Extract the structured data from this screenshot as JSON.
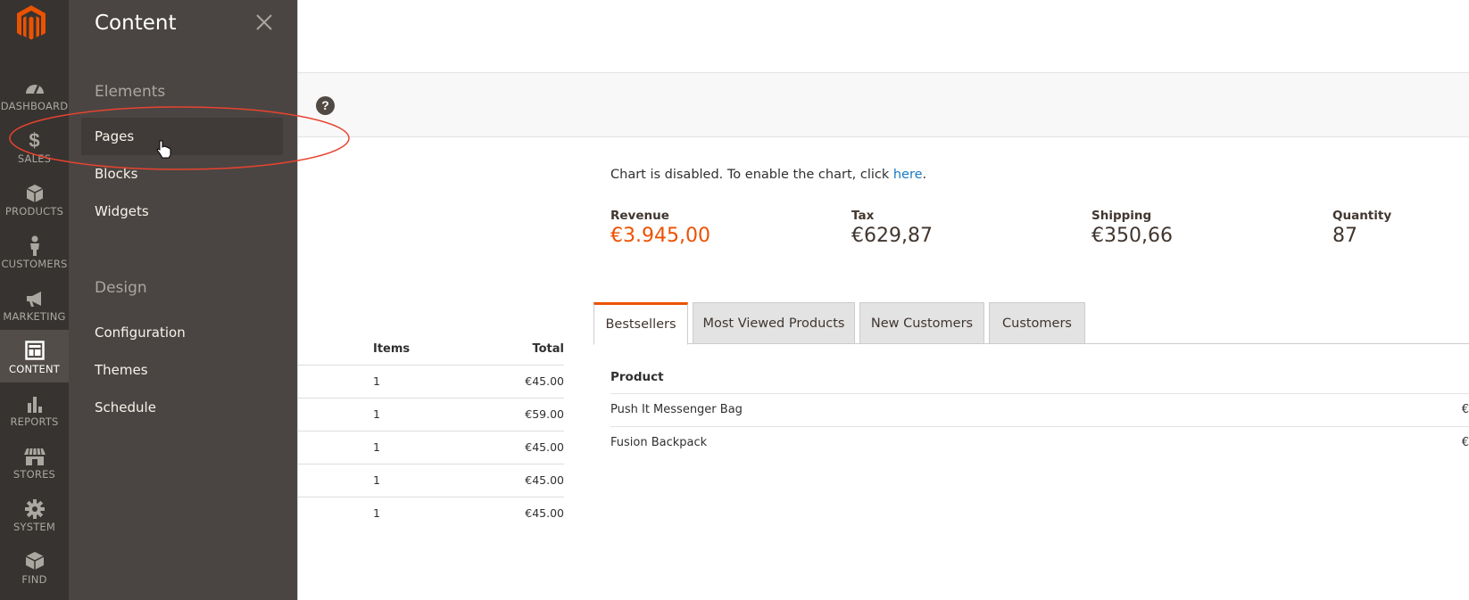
{
  "sidebar": {
    "items": [
      {
        "label": "DASHBOARD",
        "icon": "dashboard-icon"
      },
      {
        "label": "SALES",
        "icon": "dollar-icon"
      },
      {
        "label": "PRODUCTS",
        "icon": "box-icon"
      },
      {
        "label": "CUSTOMERS",
        "icon": "person-icon"
      },
      {
        "label": "MARKETING",
        "icon": "megaphone-icon"
      },
      {
        "label": "CONTENT",
        "icon": "layout-icon"
      },
      {
        "label": "REPORTS",
        "icon": "bar-chart-icon"
      },
      {
        "label": "STORES",
        "icon": "store-icon"
      },
      {
        "label": "SYSTEM",
        "icon": "gear-icon"
      },
      {
        "label": "FIND",
        "icon": "blocks-icon"
      }
    ],
    "active": "CONTENT"
  },
  "flyout": {
    "title": "Content",
    "sections": [
      {
        "heading": "Elements",
        "items": [
          "Pages",
          "Blocks",
          "Widgets"
        ]
      },
      {
        "heading": "Design",
        "items": [
          "Configuration",
          "Themes",
          "Schedule"
        ]
      }
    ]
  },
  "dashboard": {
    "chart_msg": "Chart is disabled. To enable the chart, click ",
    "chart_link": "here",
    "chart_msg_end": ".",
    "stats": [
      {
        "title": "Revenue",
        "value": "€3.945,00"
      },
      {
        "title": "Tax",
        "value": "€629,87"
      },
      {
        "title": "Shipping",
        "value": "€350,66"
      },
      {
        "title": "Quantity",
        "value": "87"
      }
    ],
    "orders": {
      "headers": {
        "items": "Items",
        "total": "Total"
      },
      "rows": [
        {
          "items": "1",
          "total": "€45.00"
        },
        {
          "items": "1",
          "total": "€59.00"
        },
        {
          "items": "1",
          "total": "€45.00"
        },
        {
          "items": "1",
          "total": "€45.00"
        },
        {
          "items": "1",
          "total": "€45.00"
        }
      ]
    },
    "tabs": [
      "Bestsellers",
      "Most Viewed Products",
      "New Customers",
      "Customers"
    ],
    "products": {
      "header": "Product",
      "rows": [
        "Push It Messenger Bag",
        "Fusion Backpack"
      ],
      "cut_text": "€"
    }
  },
  "colors": {
    "accent": "#eb5202",
    "link": "#1979c3",
    "sidebar": "#373330",
    "flyout": "#4a4542"
  }
}
